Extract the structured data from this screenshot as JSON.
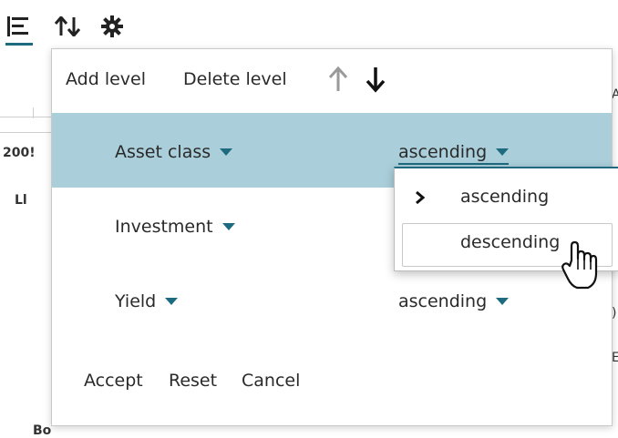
{
  "toolbar": {
    "icons": [
      "level-list-icon",
      "sort-arrows-icon",
      "gear-icon"
    ]
  },
  "background": {
    "cells": [
      "200!",
      "Ll",
      "Bo"
    ],
    "right_edge": [
      "A",
      ")",
      "E"
    ]
  },
  "panel": {
    "add_level": "Add level",
    "delete_level": "Delete level",
    "move_up_icon": "arrow-up-icon",
    "move_down_icon": "arrow-down-icon",
    "levels": [
      {
        "field": "Asset class",
        "order": "ascending",
        "selected": true
      },
      {
        "field": "Investment",
        "order": "",
        "selected": false
      },
      {
        "field": "Yield",
        "order": "ascending",
        "selected": false
      }
    ],
    "footer": {
      "accept": "Accept",
      "reset": "Reset",
      "cancel": "Cancel"
    }
  },
  "dropdown": {
    "options": [
      {
        "label": "ascending",
        "checked": true
      },
      {
        "label": "descending",
        "hovered": true
      }
    ]
  },
  "colors": {
    "accent": "#1e6b80",
    "selected_row": "#aacfdb"
  }
}
